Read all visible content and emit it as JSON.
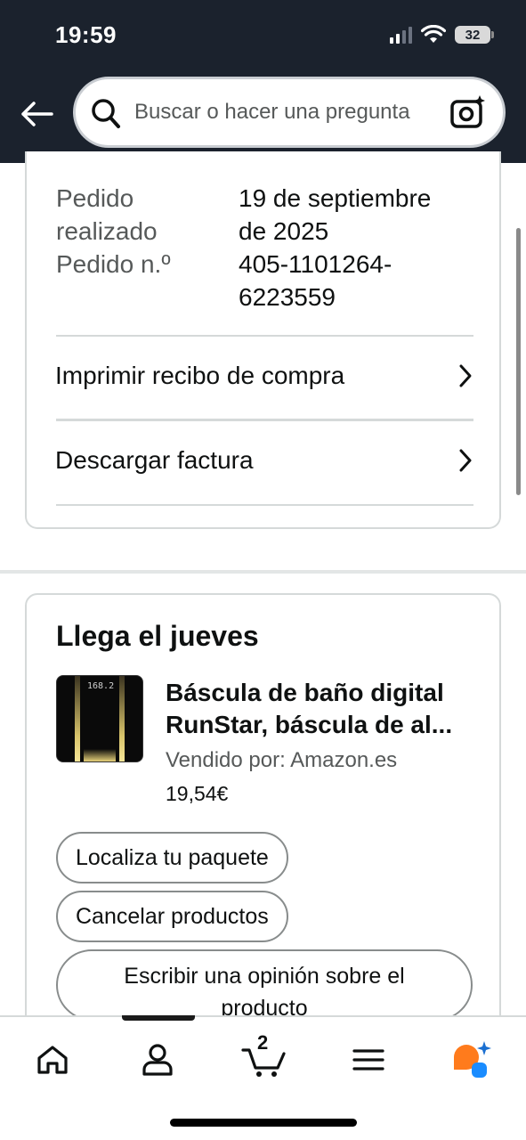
{
  "status_bar": {
    "time": "19:59",
    "battery": "32"
  },
  "search": {
    "placeholder": "Buscar o hacer una pregunta"
  },
  "order": {
    "placed_label_line1": "Pedido",
    "placed_label_line2": "realizado",
    "placed_value_line1": "19 de septiembre",
    "placed_value_line2": "de 2025",
    "number_label": "Pedido n.º",
    "number_value_line1": "405-1101264-",
    "number_value_line2": "6223559",
    "links": [
      {
        "label": "Imprimir recibo de compra"
      },
      {
        "label": "Descargar factura"
      }
    ]
  },
  "delivery": {
    "title": "Llega el jueves",
    "product": {
      "title_line1": "Báscula de baño digital",
      "title_line2": "RunStar, báscula de al...",
      "seller": "Vendido por: Amazon.es",
      "price": "19,54€",
      "screen_text": "168.2"
    },
    "buttons": {
      "track": "Localiza tu paquete",
      "cancel": "Cancelar productos",
      "review_line1": "Escribir una opinión sobre el",
      "review_line2": "producto"
    }
  },
  "nav": {
    "cart_count": "2"
  },
  "icons": {
    "back": "back-arrow-icon",
    "search": "search-icon",
    "camera": "camera-icon",
    "home": "home-icon",
    "profile": "profile-icon",
    "cart": "cart-icon",
    "menu": "menu-icon",
    "rufus": "rufus-assistant-icon"
  },
  "colors": {
    "header_bg": "#1b222d",
    "rufus_orange": "#ff7b1c",
    "rufus_blue": "#1a8cff"
  }
}
